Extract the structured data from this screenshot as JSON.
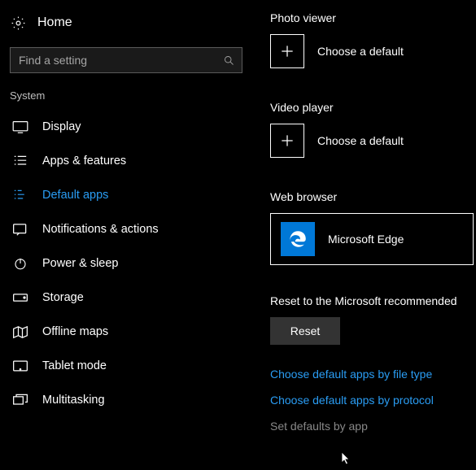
{
  "header": {
    "home": "Home"
  },
  "search": {
    "placeholder": "Find a setting"
  },
  "section_label": "System",
  "nav": [
    {
      "id": "display",
      "label": "Display"
    },
    {
      "id": "apps-features",
      "label": "Apps & features"
    },
    {
      "id": "default-apps",
      "label": "Default apps",
      "selected": true
    },
    {
      "id": "notifications",
      "label": "Notifications & actions"
    },
    {
      "id": "power-sleep",
      "label": "Power & sleep"
    },
    {
      "id": "storage",
      "label": "Storage"
    },
    {
      "id": "offline-maps",
      "label": "Offline maps"
    },
    {
      "id": "tablet-mode",
      "label": "Tablet mode"
    },
    {
      "id": "multitasking",
      "label": "Multitasking"
    }
  ],
  "main": {
    "photo": {
      "title": "Photo viewer",
      "choose": "Choose a default"
    },
    "video": {
      "title": "Video player",
      "choose": "Choose a default"
    },
    "browser": {
      "title": "Web browser",
      "app": "Microsoft Edge"
    },
    "reset_text": "Reset to the Microsoft recommended",
    "reset_button": "Reset",
    "link_filetype": "Choose default apps by file type",
    "link_protocol": "Choose default apps by protocol",
    "link_byapp": "Set defaults by app"
  }
}
